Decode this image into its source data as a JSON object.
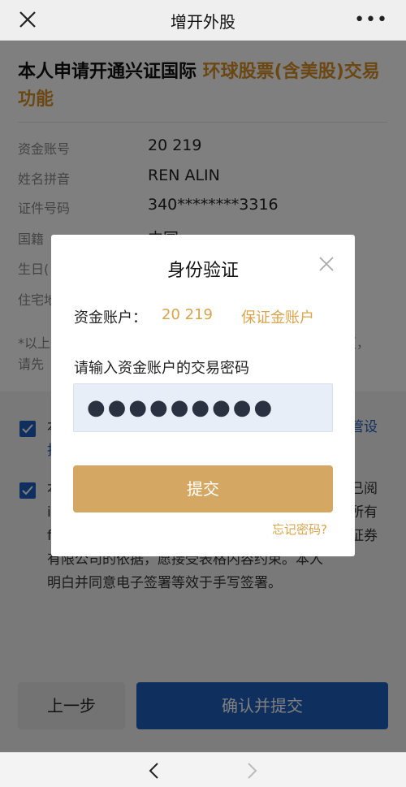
{
  "header": {
    "title": "增开外股",
    "close_icon": "close-icon",
    "more_icon": "more-icon",
    "more_glyph": "•••"
  },
  "page": {
    "heading_prefix": "本人申请开通兴证国际 ",
    "heading_highlight": "环球股票(含美股)交易功能",
    "info": [
      {
        "label": "资金账号",
        "value": "20    219"
      },
      {
        "label": "姓名拼音",
        "value": "REN  ALIN"
      },
      {
        "label": "证件号码",
        "value": "340********3316"
      },
      {
        "label": "国籍",
        "value": "中国"
      },
      {
        "label": "生日(",
        "value": ""
      },
      {
        "label": "住宅地",
        "value": ""
      }
    ],
    "note_line1": "*以上",
    "note_line1_end": "更，",
    "note_line2": "请先",
    "agree1_part1": "本",
    "agree1_link": "管设",
    "agree1_line2": "抖",
    "agree2_part1": "本",
    "agree2_end1": "已阅",
    "agree2_l2a": "i",
    "agree2_l2b": "所有",
    "agree2_l3a": "f",
    "agree2_l3b": "证券",
    "agree2_line4": "有限公司的依据，愿接受表格内容约束。本人",
    "agree2_line5": "明白并同意电子签署等效于手写签署。",
    "btn_prev": "上一步",
    "btn_confirm": "确认并提交"
  },
  "modal": {
    "title": "身份验证",
    "account_label": "资金账户：",
    "account_value": "20    219",
    "account_type": "保证金账户",
    "password_prompt": "请输入资金账户的交易密码",
    "password_mask": "●●●●●●●●●",
    "submit_label": "提交",
    "forgot_label": "忘记密码?"
  },
  "browser": {
    "back_icon": "chevron-left-icon",
    "forward_icon": "chevron-right-icon"
  },
  "colors": {
    "brand_blue": "#1e5fbf",
    "accent_gold": "#d4a762",
    "highlight_orange": "#d79026"
  }
}
